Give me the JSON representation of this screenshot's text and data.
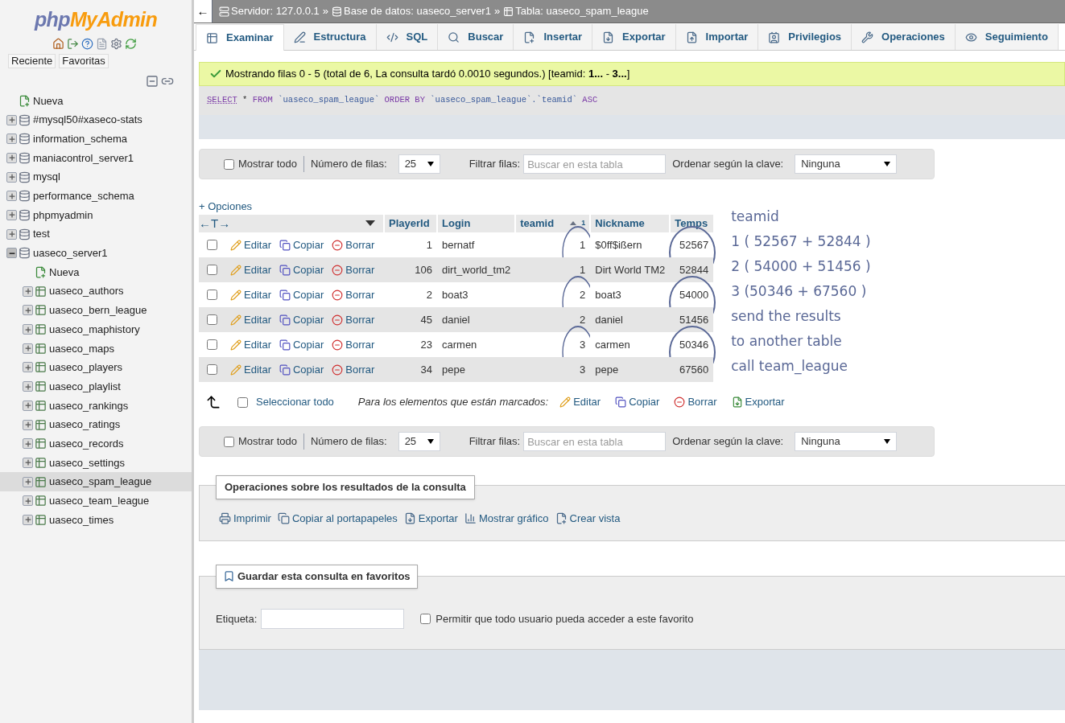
{
  "sidebar": {
    "logo": {
      "php": "php",
      "brand": "MyAdmin"
    },
    "tabs": [
      "Reciente",
      "Favoritas"
    ],
    "tree": [
      {
        "label": "Nueva",
        "kind": "new",
        "selected": false
      },
      {
        "label": "#mysql50#xaseco-stats",
        "kind": "db",
        "expanded": false,
        "selected": false
      },
      {
        "label": "information_schema",
        "kind": "db",
        "expanded": false,
        "selected": false
      },
      {
        "label": "maniacontrol_server1",
        "kind": "db",
        "expanded": false,
        "selected": false
      },
      {
        "label": "mysql",
        "kind": "db",
        "expanded": false,
        "selected": false
      },
      {
        "label": "performance_schema",
        "kind": "db",
        "expanded": false,
        "selected": false
      },
      {
        "label": "phpmyadmin",
        "kind": "db",
        "expanded": false,
        "selected": false
      },
      {
        "label": "test",
        "kind": "db",
        "expanded": false,
        "selected": false
      },
      {
        "label": "uaseco_server1",
        "kind": "db",
        "expanded": true,
        "selected": false,
        "children": [
          {
            "label": "Nueva",
            "kind": "new",
            "selected": false
          },
          {
            "label": "uaseco_authors",
            "kind": "table",
            "expanded": false,
            "selected": false
          },
          {
            "label": "uaseco_bern_league",
            "kind": "table",
            "expanded": false,
            "selected": false
          },
          {
            "label": "uaseco_maphistory",
            "kind": "table",
            "expanded": false,
            "selected": false
          },
          {
            "label": "uaseco_maps",
            "kind": "table",
            "expanded": false,
            "selected": false
          },
          {
            "label": "uaseco_players",
            "kind": "table",
            "expanded": false,
            "selected": false
          },
          {
            "label": "uaseco_playlist",
            "kind": "table",
            "expanded": false,
            "selected": false
          },
          {
            "label": "uaseco_rankings",
            "kind": "table",
            "expanded": false,
            "selected": false
          },
          {
            "label": "uaseco_ratings",
            "kind": "table",
            "expanded": false,
            "selected": false
          },
          {
            "label": "uaseco_records",
            "kind": "table",
            "expanded": false,
            "selected": false
          },
          {
            "label": "uaseco_settings",
            "kind": "table",
            "expanded": false,
            "selected": false
          },
          {
            "label": "uaseco_spam_league",
            "kind": "table",
            "expanded": false,
            "selected": true
          },
          {
            "label": "uaseco_team_league",
            "kind": "table",
            "expanded": false,
            "selected": false
          },
          {
            "label": "uaseco_times",
            "kind": "table",
            "expanded": false,
            "selected": false
          }
        ]
      }
    ]
  },
  "breadcrumb": {
    "back": "←",
    "separator": "»",
    "items": [
      {
        "label": "Servidor: 127.0.0.1",
        "kind": "server"
      },
      {
        "label": "Base de datos: uaseco_server1",
        "kind": "database"
      },
      {
        "label": "Tabla: uaseco_spam_league",
        "kind": "table"
      }
    ]
  },
  "tabs": [
    {
      "label": "Examinar",
      "kind": "browse",
      "selected": true
    },
    {
      "label": "Estructura",
      "kind": "structure",
      "selected": false
    },
    {
      "label": "SQL",
      "kind": "sql",
      "selected": false
    },
    {
      "label": "Buscar",
      "kind": "search",
      "selected": false
    },
    {
      "label": "Insertar",
      "kind": "insert",
      "selected": false
    },
    {
      "label": "Exportar",
      "kind": "export",
      "selected": false
    },
    {
      "label": "Importar",
      "kind": "import",
      "selected": false
    },
    {
      "label": "Privilegios",
      "kind": "privileges",
      "selected": false
    },
    {
      "label": "Operaciones",
      "kind": "operations",
      "selected": false
    },
    {
      "label": "Seguimiento",
      "kind": "tracking",
      "selected": false
    }
  ],
  "message": "Mostrando filas 0 - 5 (total de 6, La consulta tardó 0.0010 segundos.) [teamid: **1...** - **3...**]",
  "sql": [
    {
      "text": "SELECT",
      "kind": "select"
    },
    {
      "text": " * ",
      "kind": "plain"
    },
    {
      "text": "FROM",
      "kind": "keyword"
    },
    {
      "text": " `uaseco_spam_league` ",
      "kind": "ident"
    },
    {
      "text": "ORDER BY",
      "kind": "keyword"
    },
    {
      "text": " `uaseco_spam_league`.`teamid` ",
      "kind": "ident"
    },
    {
      "text": "ASC",
      "kind": "keyword"
    }
  ],
  "nav_top": {
    "show_all": "Mostrar todo",
    "show_all_checked": false,
    "rows_label": "Número de filas:",
    "rows_value": "25",
    "filter_label": "Filtrar filas:",
    "filter_placeholder": "Buscar en esta tabla",
    "sort_label": "Ordenar según la clave:",
    "sort_value": "Ninguna"
  },
  "table": {
    "options": "+ Opciones",
    "arrows": "←T→",
    "columns": [
      {
        "label": "PlayerId"
      },
      {
        "label": "Login"
      },
      {
        "label": "teamid",
        "sort": "1"
      },
      {
        "label": "Nickname"
      },
      {
        "label": "Temps"
      }
    ],
    "rows": [
      {
        "checked": false,
        "actions": [
          "Editar",
          "Copiar",
          "Borrar"
        ],
        "cells": [
          "1",
          "bernatf",
          "1",
          "$0ff$ißern",
          "52567"
        ]
      },
      {
        "checked": false,
        "actions": [
          "Editar",
          "Copiar",
          "Borrar"
        ],
        "cells": [
          "106",
          "dirt_world_tm2",
          "1",
          "Dirt World TM2",
          "52844"
        ]
      },
      {
        "checked": false,
        "actions": [
          "Editar",
          "Copiar",
          "Borrar"
        ],
        "cells": [
          "2",
          "boat3",
          "2",
          "boat3",
          "54000"
        ]
      },
      {
        "checked": false,
        "actions": [
          "Editar",
          "Copiar",
          "Borrar"
        ],
        "cells": [
          "45",
          "daniel",
          "2",
          "daniel",
          "51456"
        ]
      },
      {
        "checked": false,
        "actions": [
          "Editar",
          "Copiar",
          "Borrar"
        ],
        "cells": [
          "23",
          "carmen",
          "3",
          "carmen",
          "50346"
        ]
      },
      {
        "checked": false,
        "actions": [
          "Editar",
          "Copiar",
          "Borrar"
        ],
        "cells": [
          "34",
          "pepe",
          "3",
          "pepe",
          "67560"
        ]
      }
    ]
  },
  "notes": [
    "teamid",
    "1 ( 52567 + 52844 )",
    "2 ( 54000 + 51456 )",
    "3 (50346 + 67560 )",
    "send the results",
    "to another table",
    "call team_league"
  ],
  "bulk": {
    "select_all": "Seleccionar todo",
    "checked": false,
    "hint": "Para los elementos que están marcados:",
    "actions": [
      {
        "label": "Editar",
        "kind": "edit"
      },
      {
        "label": "Copiar",
        "kind": "copy"
      },
      {
        "label": "Borrar",
        "kind": "delete"
      },
      {
        "label": "Exportar",
        "kind": "export"
      }
    ]
  },
  "nav_bottom": {
    "show_all": "Mostrar todo",
    "show_all_checked": false,
    "rows_label": "Número de filas:",
    "rows_value": "25",
    "filter_label": "Filtrar filas:",
    "filter_placeholder": "Buscar en esta tabla",
    "sort_label": "Ordenar según la clave:",
    "sort_value": "Ninguna"
  },
  "operations": {
    "legend": "Operaciones sobre los resultados de la consulta",
    "items": [
      {
        "label": "Imprimir",
        "kind": "print"
      },
      {
        "label": "Copiar al portapapeles",
        "kind": "copy"
      },
      {
        "label": "Exportar",
        "kind": "export"
      },
      {
        "label": "Mostrar gráfico",
        "kind": "chart"
      },
      {
        "label": "Crear vista",
        "kind": "view"
      }
    ]
  },
  "bookmark": {
    "legend": "Guardar esta consulta en favoritos",
    "label_field": "Etiqueta:",
    "public_label": "Permitir que todo usuario pueda acceder a este favorito",
    "public_checked": false
  }
}
